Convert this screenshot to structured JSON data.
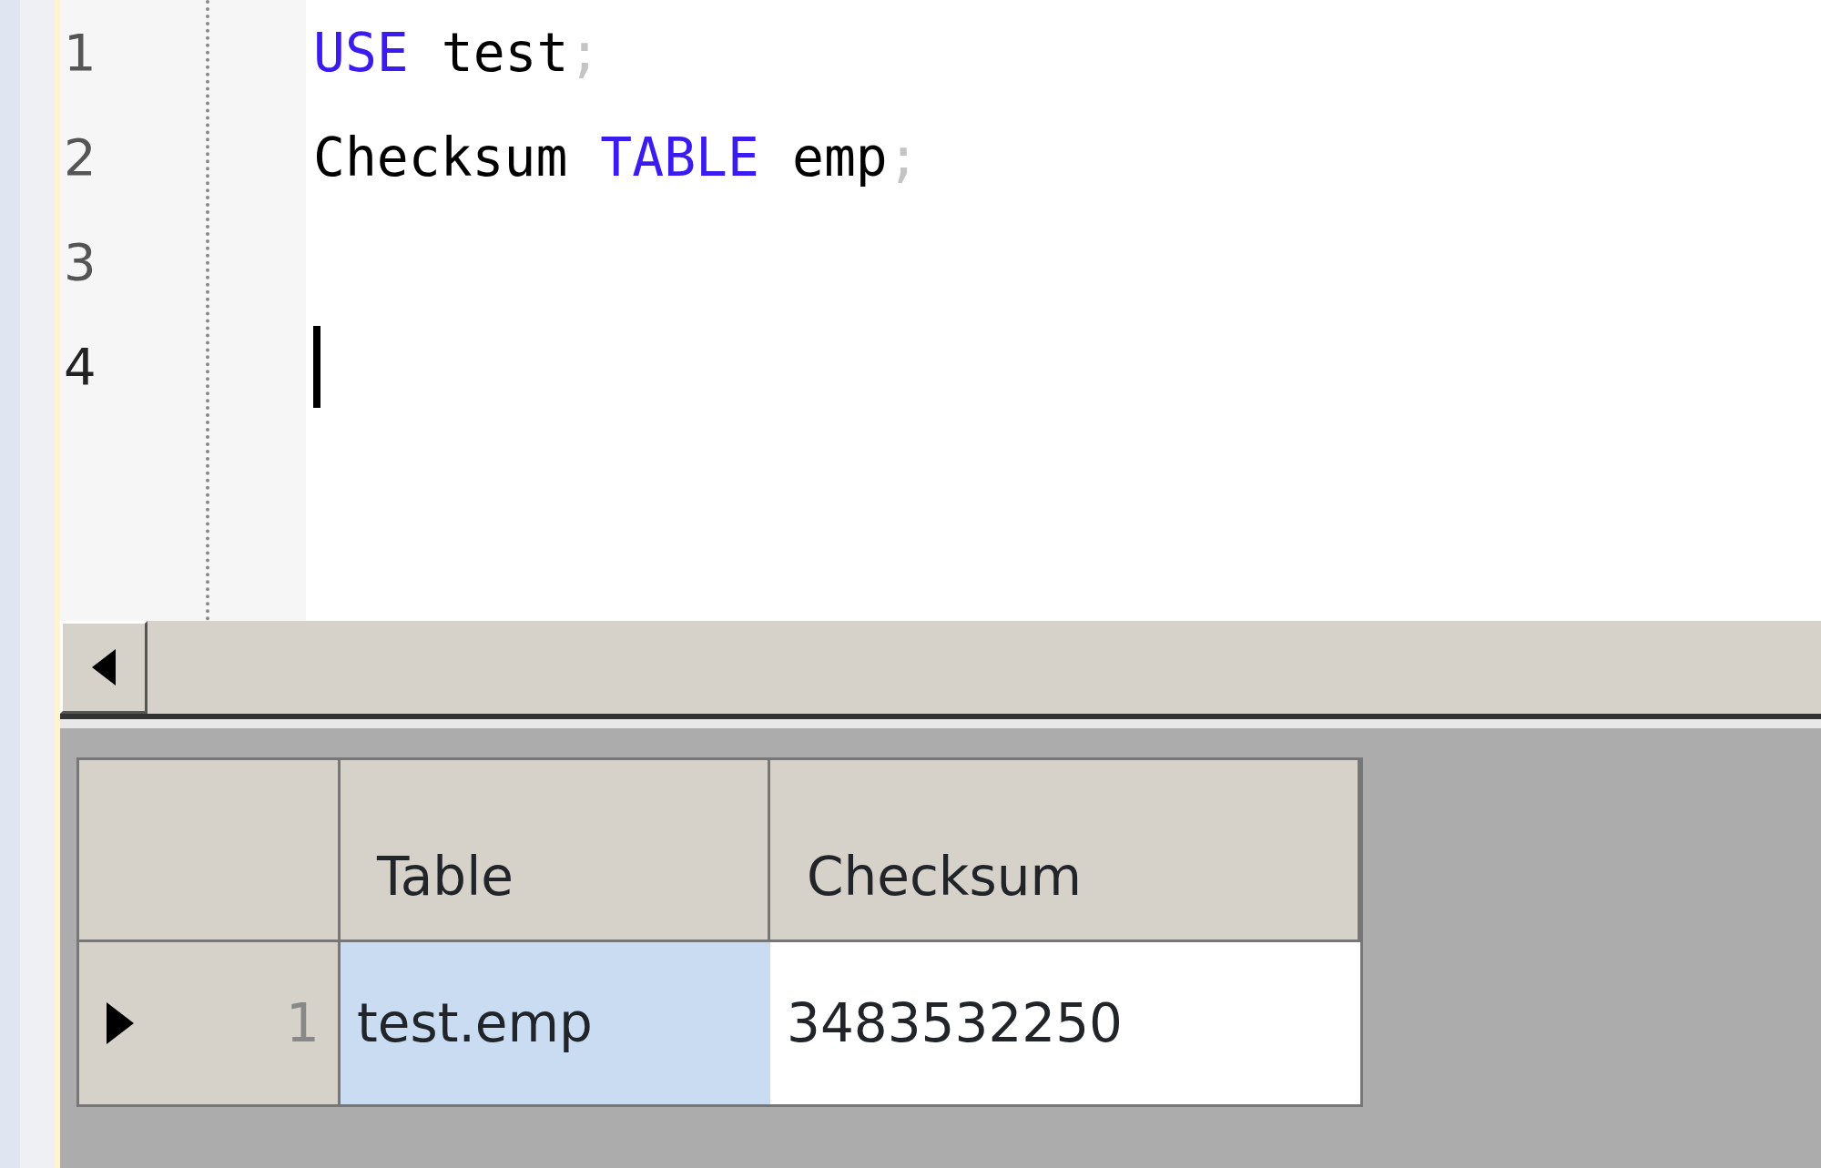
{
  "editor": {
    "lines": [
      {
        "number": "1",
        "caret": false,
        "tokens": [
          {
            "kind": "keyword",
            "text": "USE"
          },
          {
            "kind": "plain",
            "text": "test"
          },
          {
            "kind": "punct",
            "text": ";"
          }
        ]
      },
      {
        "number": "2",
        "caret": false,
        "tokens": [
          {
            "kind": "plain",
            "text": "Checksum"
          },
          {
            "kind": "keyword",
            "text": "TABLE"
          },
          {
            "kind": "plain",
            "text": "emp"
          },
          {
            "kind": "punct",
            "text": ";"
          }
        ]
      },
      {
        "number": "3",
        "caret": false
      },
      {
        "number": "4",
        "caret": true
      }
    ]
  },
  "result_grid": {
    "columns": [
      "Table",
      "Checksum"
    ],
    "rows": [
      {
        "number": "1",
        "selected": true,
        "cells": [
          {
            "text": "test.emp",
            "selected": true
          },
          {
            "text": "3483532250",
            "selected": false
          }
        ]
      }
    ]
  }
}
